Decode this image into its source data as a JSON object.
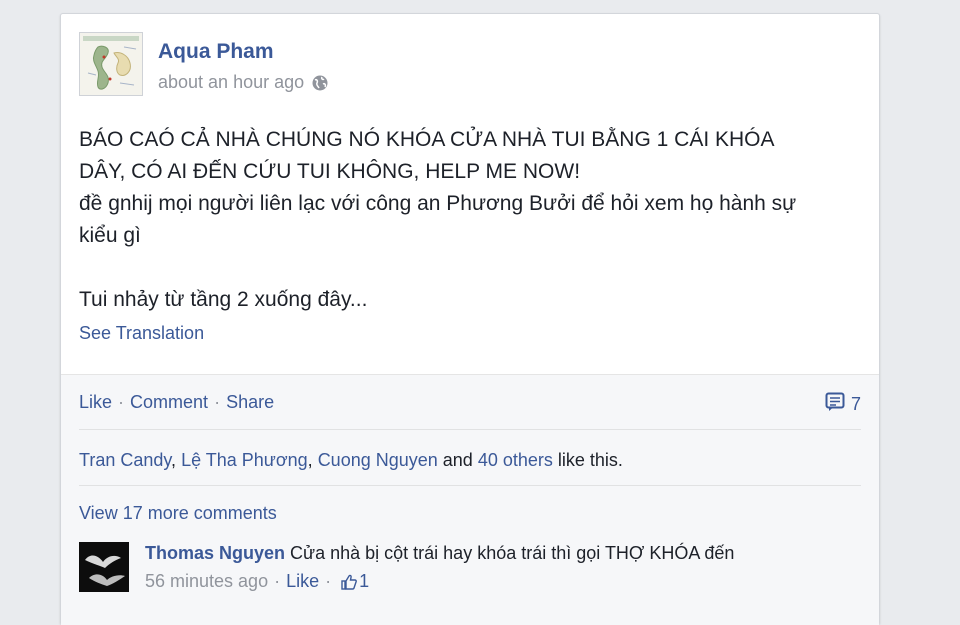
{
  "post": {
    "author": "Aqua Pham",
    "timestamp": "about an hour ago",
    "privacy_icon": "globe-icon",
    "lines": [
      "BÁO CAÓ CẢ NHÀ CHÚNG NÓ KHÓA CỬA NHÀ TUI BẰNG 1 CÁI KHÓA",
      "DÂY, CÓ AI ĐẾN CỨU TUI KHÔNG, HELP ME NOW!",
      "đề gnhij mọi người liên lạc với công an Phương Bưởi để hỏi xem họ hành sự",
      "kiểu gì",
      "Tui nhảy từ tầng 2 xuống đây..."
    ],
    "see_translation": "See Translation"
  },
  "actions": {
    "like": "Like",
    "comment": "Comment",
    "share": "Share",
    "separator": "·",
    "comment_count": "7",
    "comment_icon": "comment-icon"
  },
  "likes": {
    "names": [
      "Tran Candy",
      "Lệ Tha Phương",
      "Cuong Nguyen"
    ],
    "sep1": ", ",
    "sep2": ", ",
    "and_text": " and ",
    "others": "40 others",
    "suffix": " like this."
  },
  "comments": {
    "view_more": "View 17 more comments",
    "items": [
      {
        "name": "Thomas Nguyen",
        "text": "Cửa nhà bị cột trái hay khóa trái thì gọi THỢ KHÓA đến",
        "time": "56 minutes ago",
        "like_label": "Like",
        "separator": "·",
        "like_count": "1",
        "like_icon": "thumbs-up-icon"
      }
    ]
  }
}
